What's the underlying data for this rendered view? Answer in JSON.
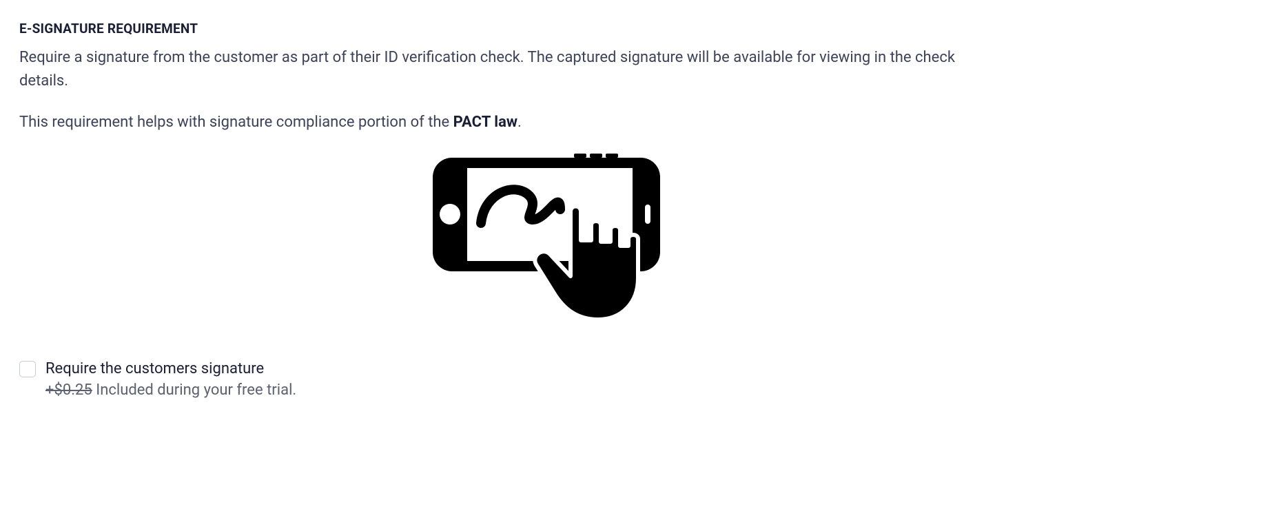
{
  "section": {
    "title": "E-SIGNATURE REQUIREMENT",
    "description": "Require a signature from the customer as part of their ID verification check. The captured signature will be available for viewing in the check details.",
    "compliance_prefix": "This requirement helps with signature compliance portion of the ",
    "compliance_bold": "PACT law",
    "compliance_suffix": "."
  },
  "icon": {
    "name": "phone-signature-icon"
  },
  "option": {
    "checkbox_label": "Require the customers signature",
    "price_struck": "+$0.25",
    "price_note": " Included during your free trial."
  }
}
